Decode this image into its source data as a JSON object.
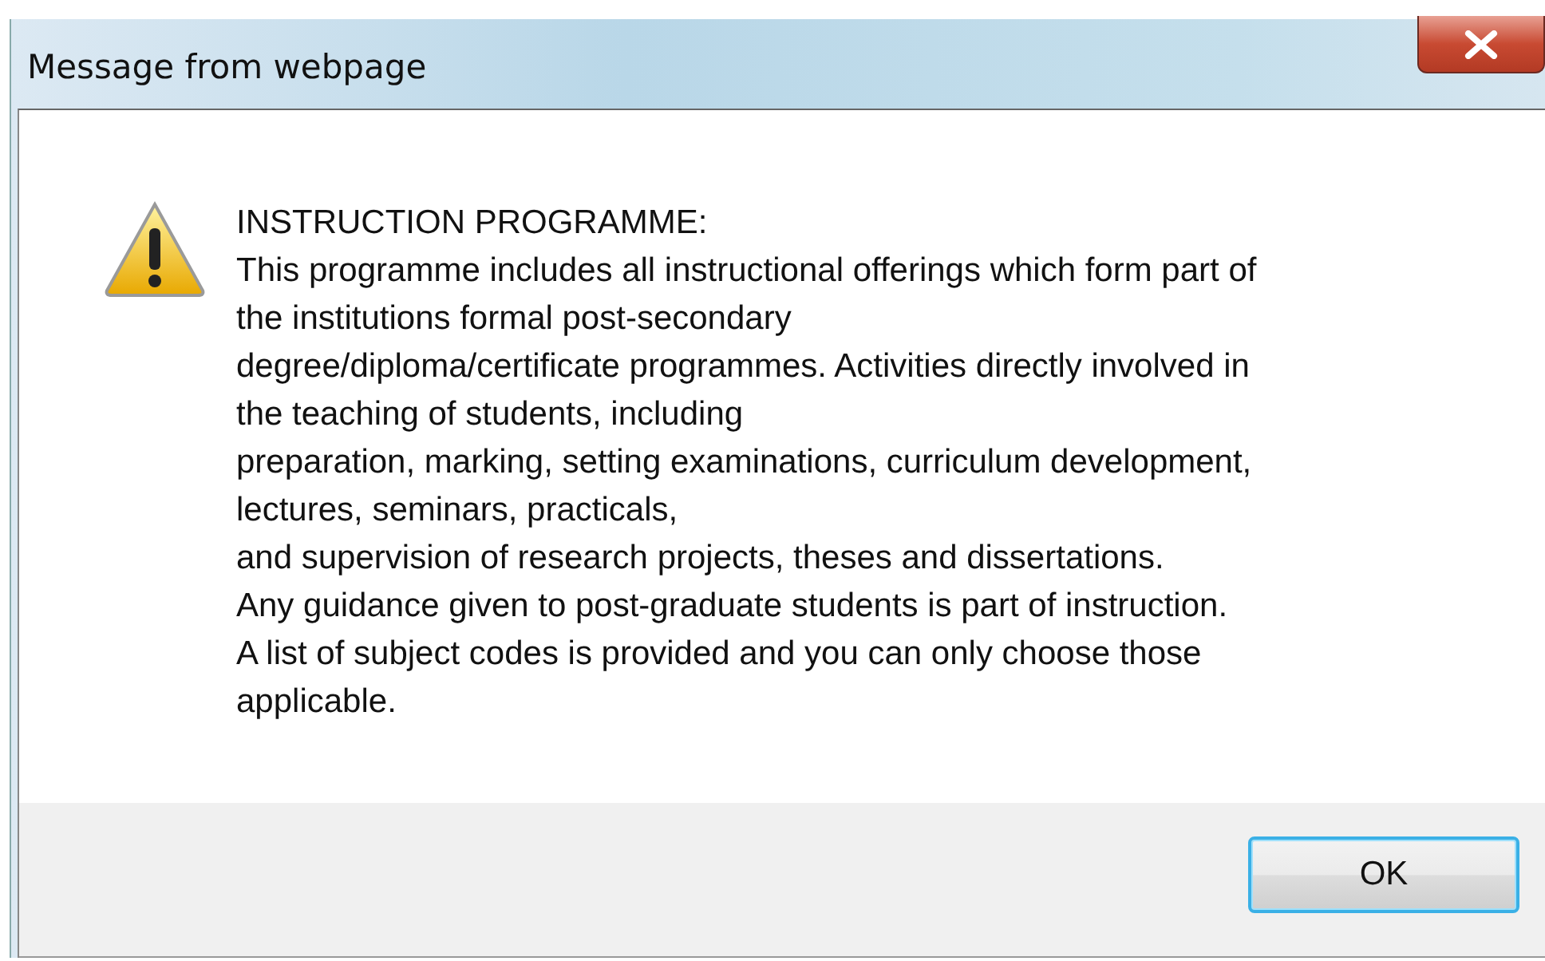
{
  "window": {
    "title": "Message from webpage"
  },
  "message": {
    "kind": "warning",
    "lines": [
      "INSTRUCTION PROGRAMME:",
      "This programme includes all instructional offerings which form part of",
      "the institutions formal post-secondary",
      "degree/diploma/certificate programmes. Activities directly involved in",
      "the teaching of students, including",
      "preparation, marking, setting examinations, curriculum development,",
      "lectures, seminars, practicals,",
      "and supervision of research projects, theses and dissertations.",
      "Any guidance given to post-graduate students is part of instruction.",
      "A list of subject codes is provided and you can only choose those",
      "applicable."
    ]
  },
  "buttons": [
    {
      "label": "OK",
      "selected": true
    }
  ]
}
